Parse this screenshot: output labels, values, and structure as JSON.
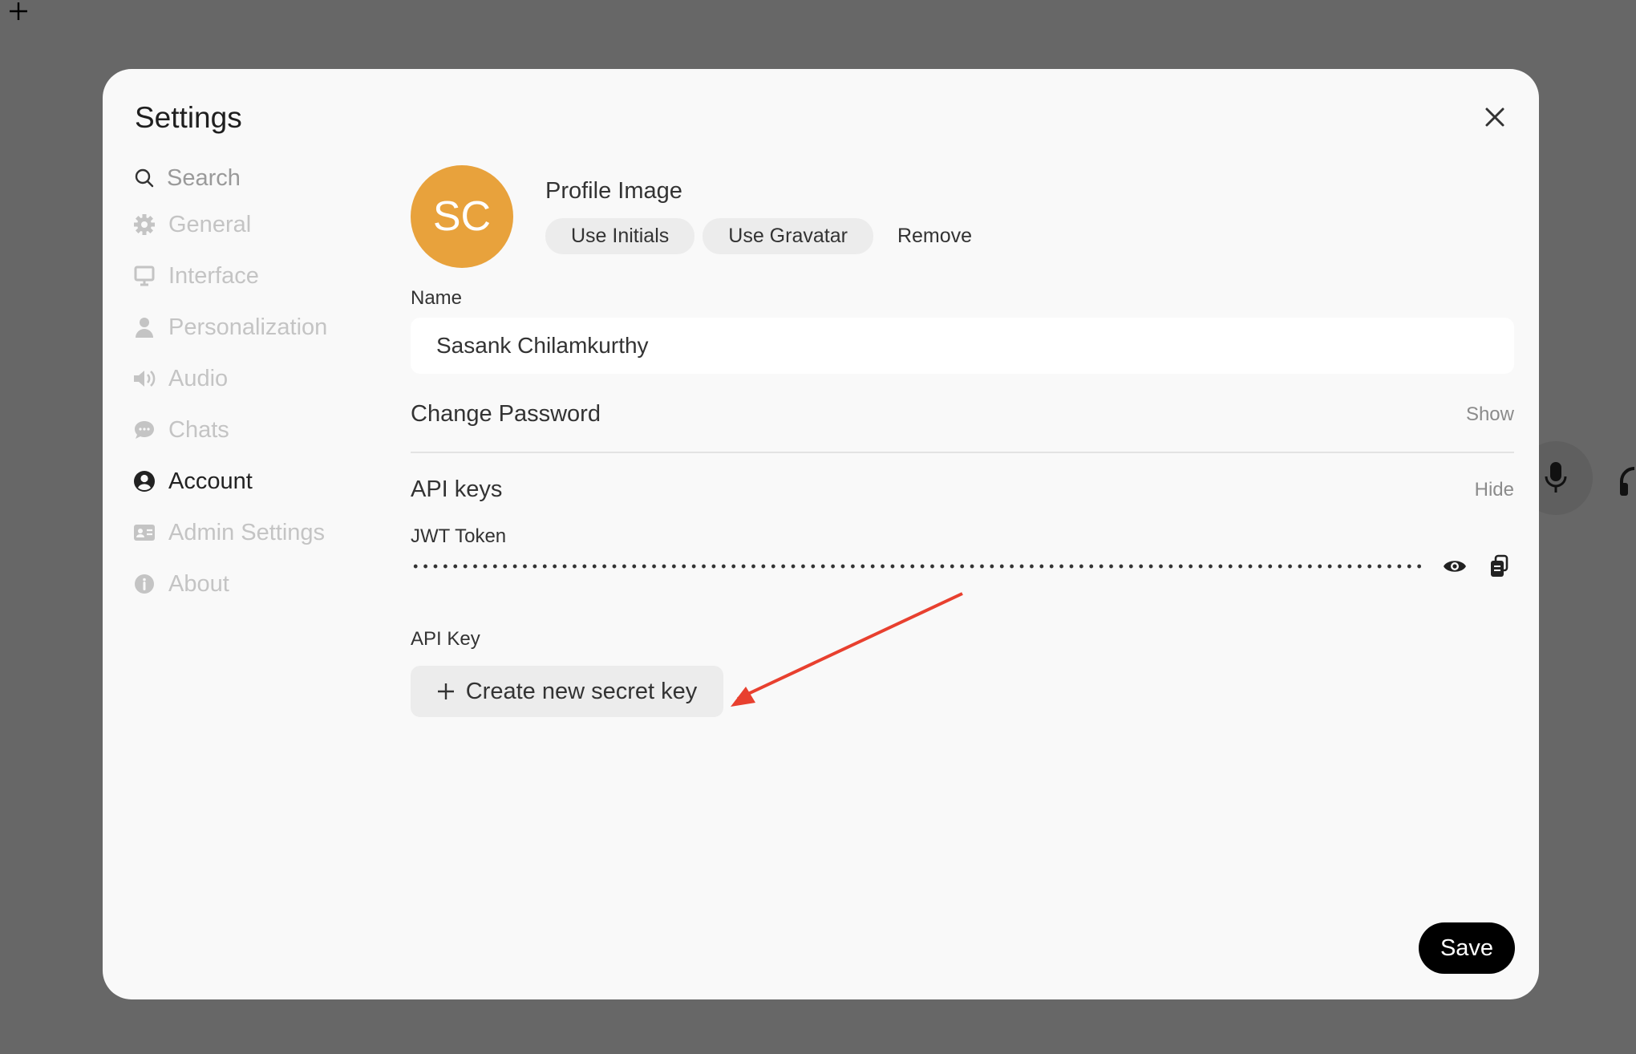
{
  "modal": {
    "title": "Settings"
  },
  "sidebar": {
    "search_placeholder": "Search",
    "items": [
      {
        "label": "General",
        "icon": "gear-icon"
      },
      {
        "label": "Interface",
        "icon": "monitor-icon"
      },
      {
        "label": "Personalization",
        "icon": "user-icon"
      },
      {
        "label": "Audio",
        "icon": "speaker-icon"
      },
      {
        "label": "Chats",
        "icon": "chat-bubble-icon"
      },
      {
        "label": "Account",
        "icon": "user-circle-icon",
        "active": true
      },
      {
        "label": "Admin Settings",
        "icon": "id-card-icon"
      },
      {
        "label": "About",
        "icon": "info-icon"
      }
    ]
  },
  "account": {
    "avatar_initials": "SC",
    "avatar_color": "#e8a23c",
    "profile_image_label": "Profile Image",
    "use_initials": "Use Initials",
    "use_gravatar": "Use Gravatar",
    "remove": "Remove",
    "name_label": "Name",
    "name_value": "Sasank Chilamkurthy",
    "change_password_label": "Change Password",
    "change_password_toggle": "Show",
    "api_keys_label": "API keys",
    "api_keys_toggle": "Hide",
    "jwt_label": "JWT Token",
    "api_key_label": "API Key",
    "create_key": "Create new secret key",
    "save": "Save"
  },
  "annotation_color": "#e8402f"
}
